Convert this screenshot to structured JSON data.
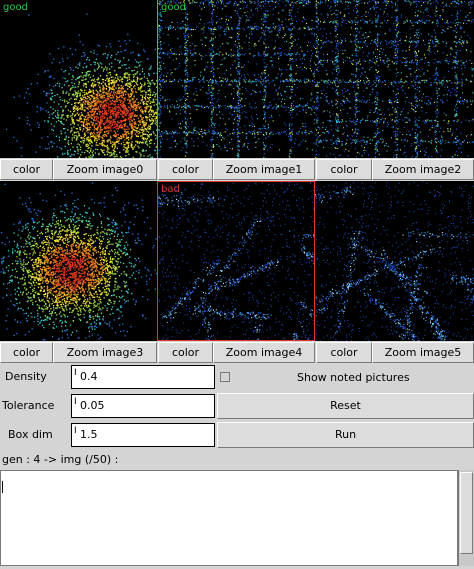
{
  "panels": [
    {
      "tag": "good",
      "tag_color": "#2ecc40",
      "border_color": "#2ecc40",
      "kind": "cluster"
    },
    {
      "tag": "good",
      "tag_color": "#2ecc40",
      "border_color": "#2ecc40",
      "kind": "grid"
    },
    {
      "tag": "",
      "tag_color": "#000000",
      "border_color": "#000000",
      "kind": "grid2"
    },
    {
      "tag": "",
      "tag_color": "#000000",
      "border_color": "#000000",
      "kind": "cluster2"
    },
    {
      "tag": "bad",
      "tag_color": "#e0342c",
      "border_color": "#e0342c",
      "kind": "streaks"
    },
    {
      "tag": "",
      "tag_color": "#000000",
      "border_color": "#000000",
      "kind": "streaks2"
    }
  ],
  "buttons": {
    "color_label": "color",
    "zoom": [
      "Zoom image0",
      "Zoom image1",
      "Zoom image2",
      "Zoom image3",
      "Zoom image4",
      "Zoom image5"
    ]
  },
  "params": {
    "density_label": "Density",
    "density_value": "0.4",
    "tolerance_label": "Tolerance",
    "tolerance_value": "0.05",
    "boxdim_label": "Box dim",
    "boxdim_value": "1.5"
  },
  "controls": {
    "show_noted_label": "Show noted pictures",
    "reset_label": "Reset",
    "run_label": "Run"
  },
  "status": {
    "gen_text": "gen : 4 -> img (/50) :"
  },
  "log": {
    "text": ""
  }
}
